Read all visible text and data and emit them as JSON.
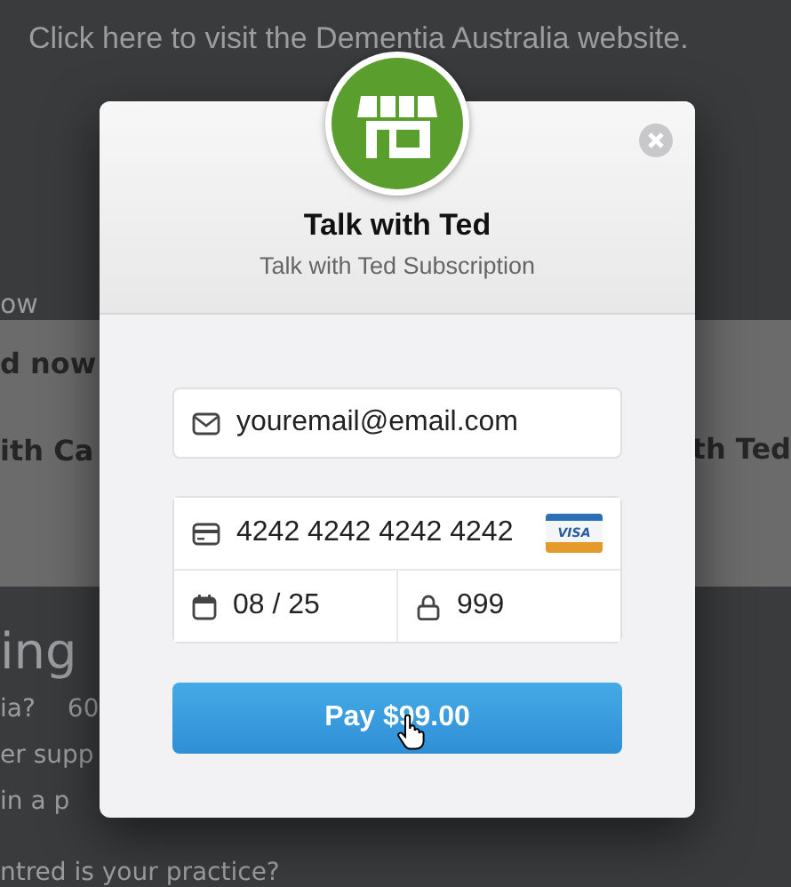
{
  "background": {
    "link_text": "Click here to visit the Dementia Australia website.",
    "band_left": [
      "ow",
      "d now",
      "ith Ca"
    ],
    "band_right": [
      "th Ted"
    ],
    "heading": "ing",
    "lines": [
      [
        "ia?",
        "60"
      ],
      [
        "er supp"
      ],
      [
        "in a p"
      ]
    ],
    "bottom_line": "ntred is your practice?"
  },
  "modal": {
    "title": "Talk with Ted",
    "subtitle": "Talk with Ted Subscription",
    "email": {
      "value": "youremail@email.com"
    },
    "card_number": {
      "value": "4242 4242 4242 4242"
    },
    "card_brand": "VISA",
    "expiry": {
      "value": "08 / 25"
    },
    "cvc": {
      "value": "999"
    },
    "pay_button": "Pay $99.00"
  }
}
